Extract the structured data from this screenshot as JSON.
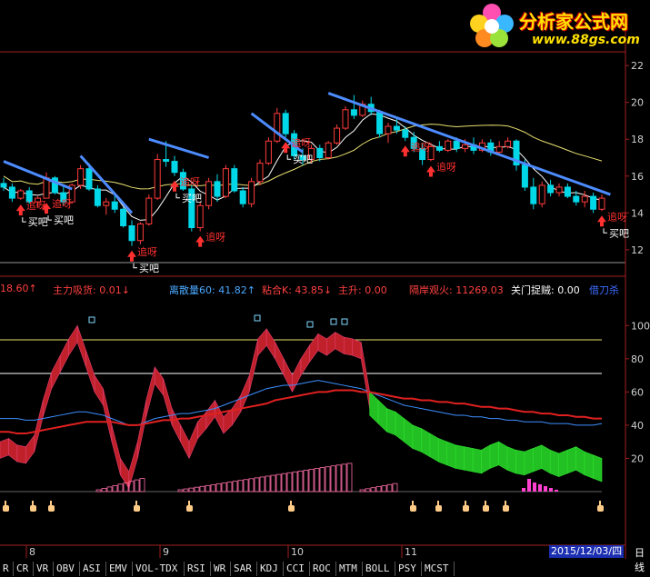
{
  "logo": {
    "title": "分析家公式网",
    "url": "www.88gs.com"
  },
  "price_axis": {
    "ticks": [
      "22",
      "20",
      "18",
      "16",
      "14",
      "12"
    ]
  },
  "indicator_axis": {
    "ticks": [
      "100",
      "80",
      "60",
      "40",
      "20"
    ]
  },
  "indicator_header": {
    "items": [
      {
        "text": "18.60↑",
        "color": "#ff4040"
      },
      {
        "text": "主力吸货: 0.01↓",
        "color": "#ff4040"
      },
      {
        "text": "离散量60: 41.82↑",
        "color": "#4aa8ff"
      },
      {
        "text": "粘合K: 43.85↓",
        "color": "#ff4040"
      },
      {
        "text": "主升: 0.00",
        "color": "#ff4040"
      },
      {
        "text": "隔岸观火: 11269.03",
        "color": "#ff4040"
      },
      {
        "text": "关门捉贼: 0.00",
        "color": "#ffffff"
      },
      {
        "text": "借刀杀",
        "color": "#3d6bff"
      }
    ]
  },
  "annotations": {
    "chase": "追呀",
    "buy": "买吧"
  },
  "x_axis": {
    "labels": [
      "8",
      "9",
      "10",
      "11"
    ],
    "date_label": "2015/12/03/四",
    "corner_label": "日线"
  },
  "indicator_tabs": [
    "R",
    "CR",
    "VR",
    "OBV",
    "ASI",
    "EMV",
    "VOL-TDX",
    "RSI",
    "WR",
    "SAR",
    "KDJ",
    "CCI",
    "ROC",
    "MTM",
    "BOLL",
    "PSY",
    "MCST"
  ],
  "colors": {
    "up": "#ff3b3b",
    "down": "#00d8e8",
    "ma_white": "#ffffff",
    "ma_yellow": "#e8e070",
    "trend": "#4d8cff",
    "thermo_red": "#c0202a",
    "thermo_green": "#22c022",
    "line_red": "#e02020",
    "line_blue": "#3d8fff"
  },
  "chart_data": [
    {
      "type": "candlestick",
      "title": "",
      "ylim": [
        11.5,
        22.5
      ],
      "series": [
        {
          "values": [
            [
              15.6,
              15.9,
              15.2,
              15.4
            ],
            [
              15.4,
              15.6,
              14.6,
              14.8
            ],
            [
              14.8,
              15.3,
              14.7,
              15.2
            ],
            [
              15.2,
              15.4,
              14.5,
              14.6
            ],
            [
              14.6,
              14.9,
              14.3,
              14.8
            ],
            [
              14.8,
              16.2,
              14.8,
              15.9
            ],
            [
              15.9,
              16.0,
              15.0,
              15.1
            ],
            [
              15.1,
              15.5,
              14.4,
              14.6
            ],
            [
              14.6,
              15.6,
              14.5,
              15.5
            ],
            [
              15.5,
              16.6,
              15.3,
              16.4
            ],
            [
              16.4,
              16.7,
              15.2,
              15.3
            ],
            [
              15.3,
              15.5,
              14.3,
              14.4
            ],
            [
              14.4,
              14.8,
              13.9,
              14.6
            ],
            [
              14.6,
              15.0,
              14.0,
              14.2
            ],
            [
              14.2,
              14.3,
              13.2,
              13.3
            ],
            [
              13.3,
              13.6,
              12.2,
              12.5
            ],
            [
              12.5,
              13.5,
              12.3,
              13.4
            ],
            [
              13.4,
              15.0,
              13.3,
              14.8
            ],
            [
              14.8,
              17.2,
              14.7,
              16.9
            ],
            [
              16.9,
              17.9,
              16.5,
              16.8
            ],
            [
              16.8,
              17.1,
              16.0,
              16.2
            ],
            [
              16.2,
              16.4,
              15.2,
              15.3
            ],
            [
              15.3,
              15.5,
              13.0,
              13.2
            ],
            [
              13.2,
              14.6,
              13.0,
              14.4
            ],
            [
              14.4,
              15.9,
              14.2,
              15.7
            ],
            [
              15.7,
              16.1,
              14.6,
              14.9
            ],
            [
              14.9,
              16.6,
              14.8,
              16.4
            ],
            [
              16.4,
              16.6,
              15.1,
              15.2
            ],
            [
              15.2,
              15.4,
              14.3,
              14.5
            ],
            [
              14.5,
              15.9,
              14.3,
              15.7
            ],
            [
              15.7,
              16.9,
              15.5,
              16.7
            ],
            [
              16.7,
              18.1,
              16.6,
              17.9
            ],
            [
              17.9,
              19.7,
              17.8,
              19.4
            ],
            [
              19.4,
              19.6,
              18.1,
              18.3
            ],
            [
              18.3,
              18.5,
              16.9,
              17.1
            ],
            [
              17.1,
              17.5,
              16.6,
              16.9
            ],
            [
              16.9,
              17.7,
              16.7,
              17.5
            ],
            [
              17.5,
              17.7,
              16.8,
              17.0
            ],
            [
              17.0,
              17.9,
              16.9,
              17.8
            ],
            [
              17.8,
              18.8,
              17.7,
              18.6
            ],
            [
              18.6,
              19.8,
              18.5,
              19.6
            ],
            [
              19.6,
              20.4,
              19.1,
              19.3
            ],
            [
              19.3,
              20.1,
              19.2,
              19.9
            ],
            [
              19.9,
              20.3,
              19.3,
              19.5
            ],
            [
              19.5,
              19.6,
              18.1,
              18.3
            ],
            [
              18.3,
              18.9,
              17.8,
              18.7
            ],
            [
              18.7,
              19.2,
              18.3,
              18.5
            ],
            [
              18.5,
              18.7,
              17.9,
              18.1
            ],
            [
              18.1,
              18.4,
              17.3,
              17.5
            ],
            [
              17.5,
              17.8,
              16.6,
              16.9
            ],
            [
              16.9,
              17.8,
              16.8,
              17.6
            ],
            [
              17.6,
              17.9,
              17.3,
              17.4
            ],
            [
              17.4,
              18.0,
              17.3,
              17.9
            ],
            [
              17.9,
              18.1,
              17.3,
              17.5
            ],
            [
              17.5,
              18.0,
              17.3,
              17.7
            ],
            [
              17.7,
              18.1,
              17.2,
              17.4
            ],
            [
              17.4,
              18.0,
              17.3,
              17.8
            ],
            [
              17.8,
              18.0,
              17.1,
              17.3
            ],
            [
              17.3,
              17.9,
              17.2,
              17.6
            ],
            [
              17.6,
              18.1,
              17.5,
              17.9
            ],
            [
              17.9,
              18.0,
              16.3,
              16.6
            ],
            [
              16.6,
              16.9,
              15.2,
              15.4
            ],
            [
              15.4,
              15.9,
              14.2,
              14.5
            ],
            [
              14.5,
              15.7,
              14.3,
              15.5
            ],
            [
              15.5,
              15.8,
              14.9,
              15.1
            ],
            [
              15.1,
              15.6,
              14.9,
              15.4
            ],
            [
              15.4,
              15.6,
              14.8,
              14.9
            ],
            [
              14.9,
              15.2,
              14.4,
              14.6
            ],
            [
              14.6,
              15.2,
              14.3,
              14.9
            ],
            [
              14.9,
              15.1,
              14.0,
              14.2
            ],
            [
              14.2,
              15.0,
              14.1,
              14.8
            ]
          ]
        }
      ]
    },
    {
      "type": "line",
      "title": "",
      "ylim": [
        0,
        110
      ],
      "series": [
        {
          "values": [
            30,
            32,
            28,
            27,
            34,
            55,
            72,
            82,
            92,
            100,
            85,
            70,
            62,
            40,
            20,
            12,
            30,
            55,
            75,
            68,
            50,
            40,
            30,
            42,
            48,
            55,
            45,
            50,
            58,
            70,
            92,
            98,
            90,
            80,
            70,
            80,
            88,
            95,
            92,
            96,
            93,
            92,
            90,
            60,
            55,
            50,
            48,
            44,
            40,
            38,
            35,
            32,
            30,
            28,
            27,
            26,
            25,
            28,
            30,
            27,
            25,
            24,
            26,
            28,
            25,
            23,
            25,
            27,
            24,
            22,
            20
          ]
        },
        {
          "values": [
            36,
            36,
            35,
            35,
            36,
            37,
            38,
            39,
            40,
            41,
            42,
            42,
            42,
            42,
            41,
            40,
            40,
            41,
            42,
            43,
            43,
            44,
            44,
            45,
            46,
            47,
            48,
            49,
            50,
            51,
            52,
            53,
            55,
            56,
            57,
            58,
            59,
            60,
            60,
            61,
            61,
            61,
            60,
            60,
            59,
            58,
            57,
            56,
            56,
            55,
            55,
            54,
            54,
            53,
            53,
            52,
            51,
            51,
            50,
            50,
            49,
            48,
            48,
            47,
            47,
            46,
            46,
            45,
            45,
            44,
            44
          ]
        },
        {
          "values": [
            44,
            44,
            44,
            43,
            43,
            44,
            45,
            46,
            47,
            48,
            48,
            47,
            46,
            44,
            42,
            40,
            40,
            42,
            44,
            45,
            46,
            47,
            47,
            48,
            49,
            50,
            52,
            54,
            56,
            58,
            60,
            62,
            63,
            64,
            64,
            65,
            66,
            67,
            66,
            65,
            64,
            63,
            62,
            60,
            58,
            56,
            54,
            52,
            51,
            50,
            49,
            48,
            47,
            46,
            46,
            45,
            45,
            44,
            44,
            43,
            43,
            42,
            42,
            42,
            41,
            41,
            41,
            40,
            40,
            40,
            41
          ]
        }
      ]
    }
  ]
}
